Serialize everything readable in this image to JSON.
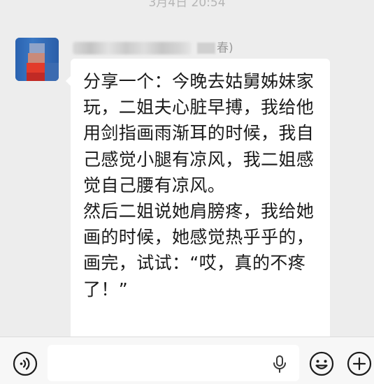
{
  "chat": {
    "timestamp": "3月4日 20:54",
    "sender_suffix": "春)",
    "message": "分享一个：今晚去姑舅姊妹家玩，二姐夫心脏早搏，我给他用剑指画雨渐耳的时候，我自己感觉小腿有凉风，我二姐感觉自己腰有凉风。\n然后二姐说她肩膀疼，我给她画的时候，她感觉热乎乎的，画完，试试：“哎，真的不疼了！”"
  },
  "input_bar": {
    "text_value": "",
    "icons": {
      "voice": "voice-mode-icon",
      "mic": "microphone-icon",
      "emoji": "emoji-icon",
      "more": "plus-icon"
    }
  },
  "colors": {
    "chat_background": "#ededed",
    "bubble": "#ffffff",
    "text": "#1a1a1a",
    "meta_text": "#b5b5b5"
  }
}
